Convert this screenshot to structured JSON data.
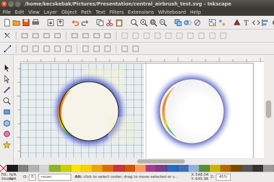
{
  "window": {
    "title": "/home/kecskebak/Pictures/Presentation/central_airbrush_test.svg - Inkscape"
  },
  "menu": [
    "File",
    "Edit",
    "View",
    "Layer",
    "Object",
    "Path",
    "Text",
    "Filters",
    "Extensions",
    "Whiteboard",
    "Help"
  ],
  "palette": {
    "colors": [
      "#1a1a1a",
      "#808080",
      "#b3b3b3",
      "#d4d4d4",
      "#8db32a",
      "#c6d200",
      "#ffe500",
      "#f7d000",
      "#e8a600",
      "#e06a00",
      "#c83737",
      "#d45500",
      "#ff9955",
      "#a33d8a",
      "#7c3a8c",
      "#2a6ac1",
      "#3e6fb5",
      "#8fb1d9",
      "#5b8c3a",
      "#c8b400",
      "#b46b00",
      "#7a4a00",
      "#555555",
      "#333333",
      "#999999"
    ]
  },
  "status": {
    "fill_label": "Fill:",
    "fill_value": "N/A",
    "stroke_label": "Stroke:",
    "stroke_value": "N/A",
    "opacity_label": "O:",
    "opacity_value": "0",
    "layer_value": "•scan",
    "message_bold": "Alt:",
    "message": "click to select under; drag to move selected or s...",
    "x_label": "X:",
    "x_value": "548.04",
    "y_label": "Y:",
    "y_value": "645.96",
    "zoom_label": "Z:",
    "zoom_value": "45%"
  },
  "colors": {
    "ubuntu_orange": "#e95420",
    "title_bg": "#3c3b37",
    "chrome": "#edeceb"
  }
}
